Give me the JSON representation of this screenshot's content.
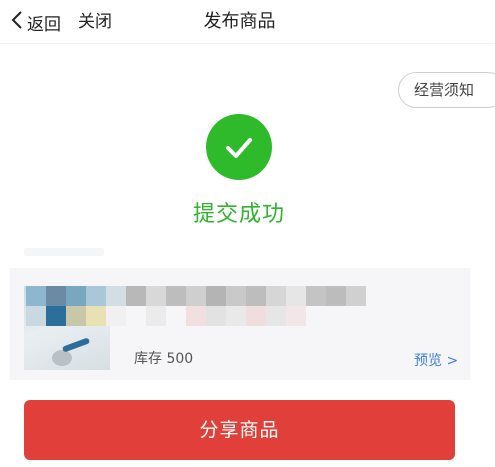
{
  "nav": {
    "back_label": "返回",
    "close_label": "关闭",
    "title": "发布商品"
  },
  "notice": {
    "label": "经营须知"
  },
  "status": {
    "text": "提交成功",
    "color": "#30b32d"
  },
  "product": {
    "stock_text": "库存 500",
    "preview_label": "预览 >"
  },
  "actions": {
    "share_label": "分享商品",
    "share_color": "#e04039"
  },
  "icons": {
    "back": "chevron-left-icon",
    "success": "check-circle-icon"
  }
}
